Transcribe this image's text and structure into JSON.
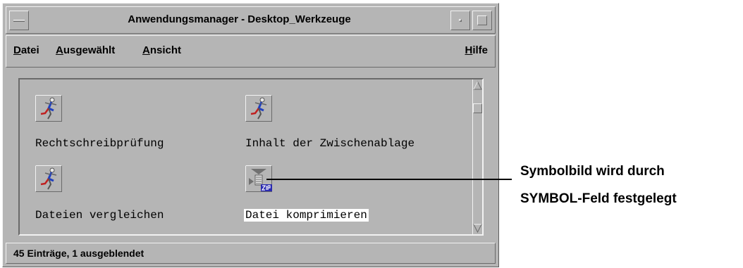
{
  "window": {
    "title": "Anwendungsmanager - Desktop_Werkzeuge"
  },
  "menu": {
    "datei": {
      "mnemonic": "D",
      "rest": "atei"
    },
    "ausgewaehlt": {
      "mnemonic": "A",
      "rest": "usgewählt"
    },
    "ansicht": {
      "mnemonic": "A",
      "rest": "nsicht"
    },
    "hilfe": {
      "mnemonic": "H",
      "rest": "ilfe"
    }
  },
  "items": [
    {
      "label": "Rechtschreibprüfung",
      "icon": "runner-icon"
    },
    {
      "label": "Inhalt der Zwischenablage",
      "icon": "runner-icon"
    },
    {
      "label": "Dateien vergleichen",
      "icon": "runner-icon"
    },
    {
      "label": "Datei komprimieren",
      "icon": "zip-icon",
      "selected": true
    }
  ],
  "status": {
    "text": "45 Einträge, 1 ausgeblendet"
  },
  "callout": {
    "line1": "Symbolbild wird durch",
    "line2": "SYMBOL-Feld festgelegt"
  },
  "colors": {
    "window_bg": "#b5b5b5",
    "highlight": "#f2f2f2",
    "shadow": "#6a6a6a",
    "zip_badge": "#2a2ab0",
    "runner_shirt": "#2040c0",
    "runner_shorts": "#c02020"
  }
}
